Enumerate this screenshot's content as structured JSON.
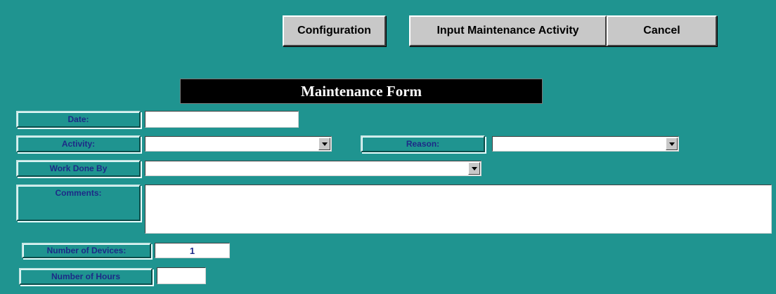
{
  "toolbar": {
    "configuration_label": "Configuration",
    "input_activity_label": "Input Maintenance Activity",
    "cancel_label": "Cancel"
  },
  "form": {
    "title": "Maintenance Form",
    "date_label": "Date:",
    "date_value": "",
    "activity_label": "Activity:",
    "activity_value": "",
    "reason_label": "Reason:",
    "reason_value": "",
    "work_done_by_label": "Work Done By",
    "work_done_by_value": "",
    "comments_label": "Comments:",
    "comments_value": "",
    "num_devices_label": "Number of Devices:",
    "num_devices_value": "1",
    "num_hours_label": "Number of Hours",
    "num_hours_value": ""
  },
  "colors": {
    "background": "#1f9490",
    "label_text": "#1d2a87",
    "title_bg": "#000000",
    "button_face": "#c8c8c8"
  },
  "icons": {
    "combo_arrow": "chevron-down-icon"
  }
}
